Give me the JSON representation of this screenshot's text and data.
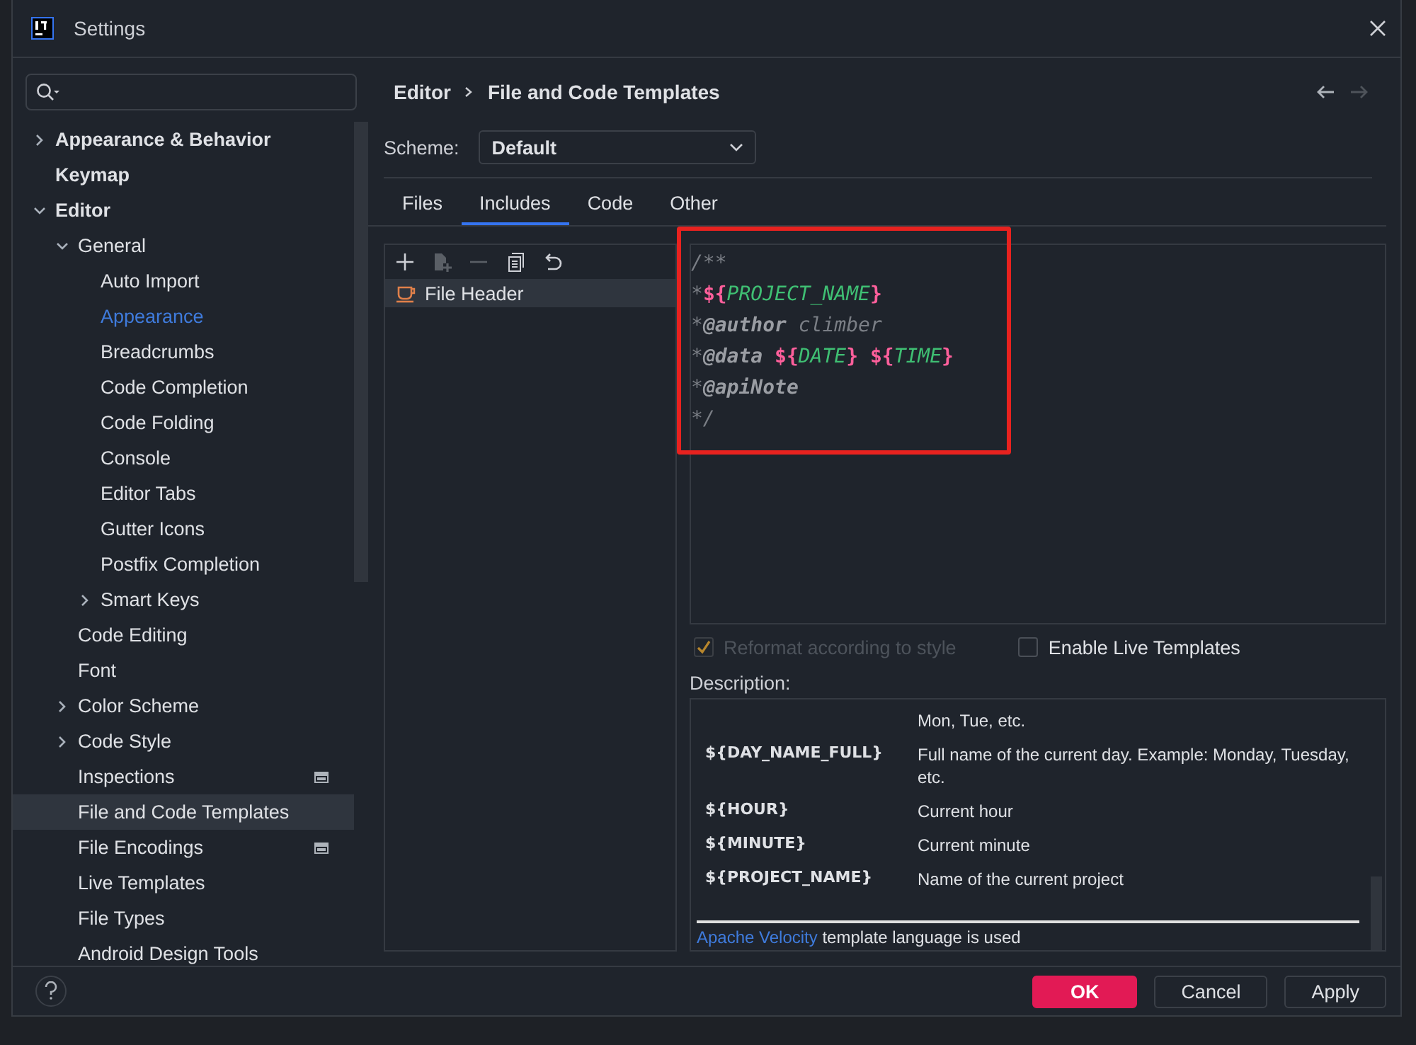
{
  "window": {
    "title": "Settings"
  },
  "sidebar": {
    "tree": [
      {
        "label": "Appearance & Behavior",
        "expanded": false,
        "selected": false
      },
      {
        "label": "Keymap",
        "selected": false
      },
      {
        "label": "Editor",
        "expanded": true,
        "selected": false,
        "children": [
          {
            "label": "General",
            "expanded": true,
            "selected": false,
            "children": [
              {
                "label": "Auto Import",
                "selected": false
              },
              {
                "label": "Appearance",
                "selected": false,
                "highlighted": true
              },
              {
                "label": "Breadcrumbs",
                "selected": false
              },
              {
                "label": "Code Completion",
                "selected": false
              },
              {
                "label": "Code Folding",
                "selected": false
              },
              {
                "label": "Console",
                "selected": false
              },
              {
                "label": "Editor Tabs",
                "selected": false
              },
              {
                "label": "Gutter Icons",
                "selected": false
              },
              {
                "label": "Postfix Completion",
                "selected": false
              },
              {
                "label": "Smart Keys",
                "expanded": false,
                "selected": false
              }
            ]
          },
          {
            "label": "Code Editing",
            "selected": false
          },
          {
            "label": "Font",
            "selected": false
          },
          {
            "label": "Color Scheme",
            "expanded": false,
            "selected": false
          },
          {
            "label": "Code Style",
            "expanded": false,
            "selected": false
          },
          {
            "label": "Inspections",
            "selected": false,
            "project_scope": true
          },
          {
            "label": "File and Code Templates",
            "selected": true
          },
          {
            "label": "File Encodings",
            "selected": false,
            "project_scope": true
          },
          {
            "label": "Live Templates",
            "selected": false
          },
          {
            "label": "File Types",
            "selected": false
          },
          {
            "label": "Android Design Tools",
            "selected": false
          }
        ]
      }
    ]
  },
  "breadcrumb": [
    "Editor",
    "File and Code Templates"
  ],
  "scheme": {
    "label": "Scheme:",
    "value": "Default"
  },
  "tabs": [
    {
      "label": "Files",
      "selected": false
    },
    {
      "label": "Includes",
      "selected": true
    },
    {
      "label": "Code",
      "selected": false
    },
    {
      "label": "Other",
      "selected": false
    }
  ],
  "templates": [
    {
      "label": "File Header",
      "selected": true
    }
  ],
  "editor": {
    "highlight_box": true,
    "lines": [
      [
        {
          "kind": "comment",
          "text": "/**"
        }
      ],
      [
        {
          "kind": "comment",
          "text": "*"
        },
        {
          "kind": "delim",
          "text": "${"
        },
        {
          "kind": "variable",
          "text": "PROJECT_NAME"
        },
        {
          "kind": "delim",
          "text": "}"
        }
      ],
      [
        {
          "kind": "comment",
          "text": "*"
        },
        {
          "kind": "tag",
          "text": "@author"
        },
        {
          "kind": "comment",
          "text": " climber"
        }
      ],
      [
        {
          "kind": "comment",
          "text": "*"
        },
        {
          "kind": "tag",
          "text": "@data "
        },
        {
          "kind": "delim",
          "text": "${"
        },
        {
          "kind": "variable",
          "text": "DATE"
        },
        {
          "kind": "delim",
          "text": "} ${"
        },
        {
          "kind": "variable",
          "text": "TIME"
        },
        {
          "kind": "delim",
          "text": "}"
        }
      ],
      [
        {
          "kind": "comment",
          "text": "*"
        },
        {
          "kind": "tag",
          "text": "@apiNote"
        }
      ],
      [
        {
          "kind": "comment",
          "text": "*/"
        }
      ]
    ]
  },
  "options": [
    {
      "label": "Reformat according to style",
      "checked": true,
      "disabled": true
    },
    {
      "label": "Enable Live Templates",
      "checked": false,
      "disabled": false
    }
  ],
  "description": {
    "label": "Description:",
    "rows": [
      {
        "description": "Mon, Tue, etc."
      },
      {
        "variable": "${DAY_NAME_FULL}",
        "description": "Full name of the current day. Example: Monday, Tuesday, etc."
      },
      {
        "variable": "${HOUR}",
        "description": "Current hour"
      },
      {
        "variable": "${MINUTE}",
        "description": "Current minute"
      },
      {
        "variable": "${PROJECT_NAME}",
        "description": "Name of the current project"
      }
    ],
    "footer_link": "Apache Velocity",
    "footer_text": "template language is used"
  },
  "buttons": [
    {
      "label": "OK",
      "kind": "primary"
    },
    {
      "label": "Cancel",
      "kind": "default"
    },
    {
      "label": "Apply",
      "kind": "default"
    }
  ]
}
